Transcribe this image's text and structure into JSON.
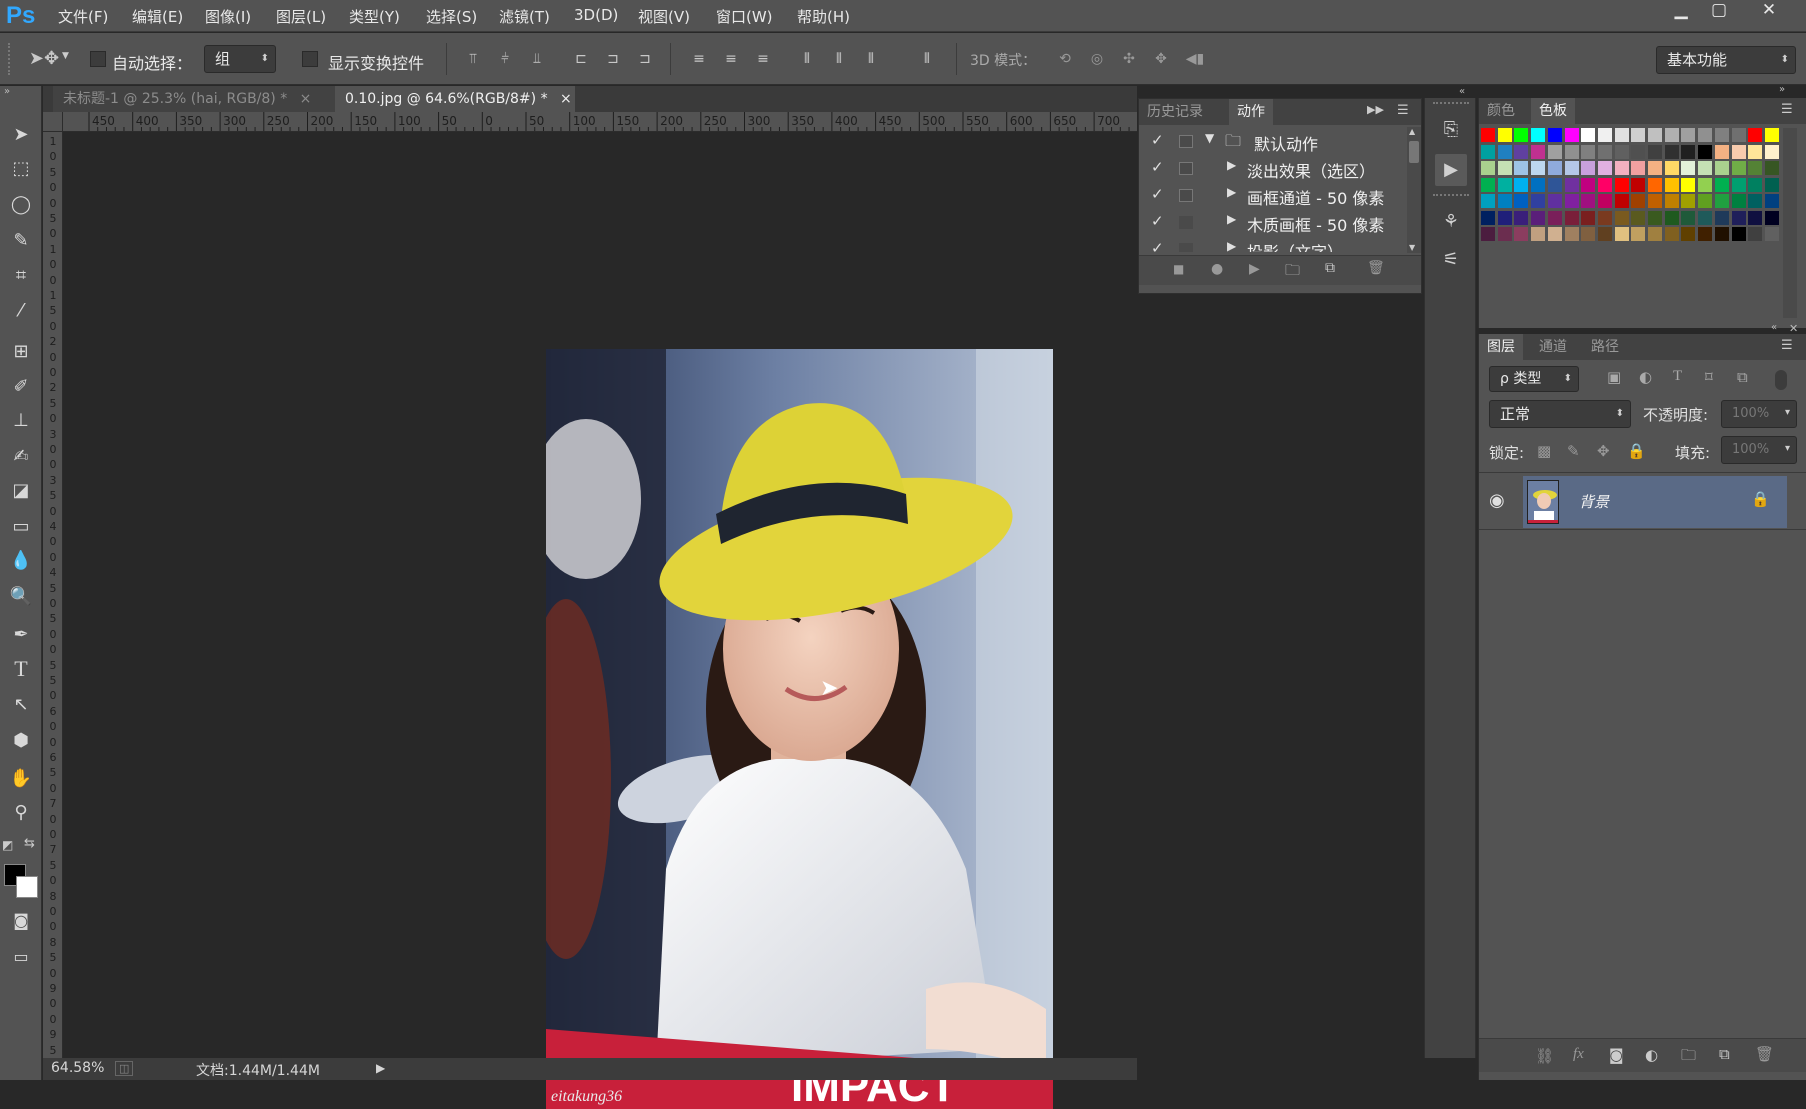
{
  "app": {
    "logo": "Ps"
  },
  "menu": [
    "文件(F)",
    "编辑(E)",
    "图像(I)",
    "图层(L)",
    "类型(Y)",
    "选择(S)",
    "滤镜(T)",
    "3D(D)",
    "视图(V)",
    "窗口(W)",
    "帮助(H)"
  ],
  "window_controls": {
    "minimize": "▁",
    "restore": "▢",
    "close": "✕"
  },
  "options": {
    "auto_select_label": "自动选择：",
    "auto_select_value": "组",
    "show_transform_label": "显示变换控件",
    "mode_3d_label": "3D 模式：",
    "workspace": "基本功能"
  },
  "tabs": [
    {
      "title": "未标题-1 @ 25.3% (hai, RGB/8) *",
      "close": "×",
      "active": false
    },
    {
      "title": "0.10.jpg @ 64.6%(RGB/8#) *",
      "close": "×",
      "active": true
    }
  ],
  "ruler_h": [
    "450",
    "400",
    "350",
    "300",
    "250",
    "200",
    "150",
    "100",
    "50",
    "0",
    "50",
    "100",
    "150",
    "200",
    "250",
    "300",
    "350",
    "400",
    "450",
    "500",
    "550",
    "600",
    "650",
    "700"
  ],
  "ruler_v": [
    "1",
    "0",
    "5",
    "0",
    "0",
    "5",
    "0",
    "1",
    "0",
    "0",
    "1",
    "5",
    "0",
    "2",
    "0",
    "0",
    "2",
    "5",
    "0",
    "3",
    "0",
    "0",
    "3",
    "5",
    "0",
    "4",
    "0",
    "0",
    "4",
    "5",
    "0",
    "5",
    "0",
    "0",
    "5",
    "5",
    "0",
    "6",
    "0",
    "0",
    "6",
    "5",
    "0",
    "7",
    "0",
    "0",
    "7",
    "5",
    "0",
    "8",
    "0",
    "0",
    "8",
    "5",
    "0",
    "9",
    "0",
    "0",
    "9",
    "5",
    "0"
  ],
  "photo": {
    "watermark": "eitakung36",
    "banner_text": "IMPACT"
  },
  "status": {
    "zoom": "64.58%",
    "doc": "文档:1.44M/1.44M"
  },
  "actions_panel": {
    "tab_history": "历史记录",
    "tab_actions": "动作",
    "rows": [
      {
        "label": "默认动作",
        "folder": true
      },
      {
        "label": "淡出效果（选区）",
        "folder": false
      },
      {
        "label": "画框通道 - 50 像素",
        "folder": false
      },
      {
        "label": "木质画框 - 50 像素",
        "folder": false
      },
      {
        "label": "投影（文字）",
        "folder": false
      }
    ]
  },
  "swatch_panel": {
    "tab_color": "颜色",
    "tab_swatches": "色板"
  },
  "layers_panel": {
    "tab_layers": "图层",
    "tab_channels": "通道",
    "tab_paths": "路径",
    "filter_kind": "ρ 类型",
    "blend_mode": "正常",
    "opacity_label": "不透明度:",
    "opacity_value": "100%",
    "lock_label": "锁定:",
    "fill_label": "填充:",
    "fill_value": "100%",
    "layer_name": "背景"
  },
  "colors": {
    "panel": "#535353",
    "dark": "#282828",
    "accent": "#31a8ff",
    "layer_selected": "#5a6a86"
  }
}
